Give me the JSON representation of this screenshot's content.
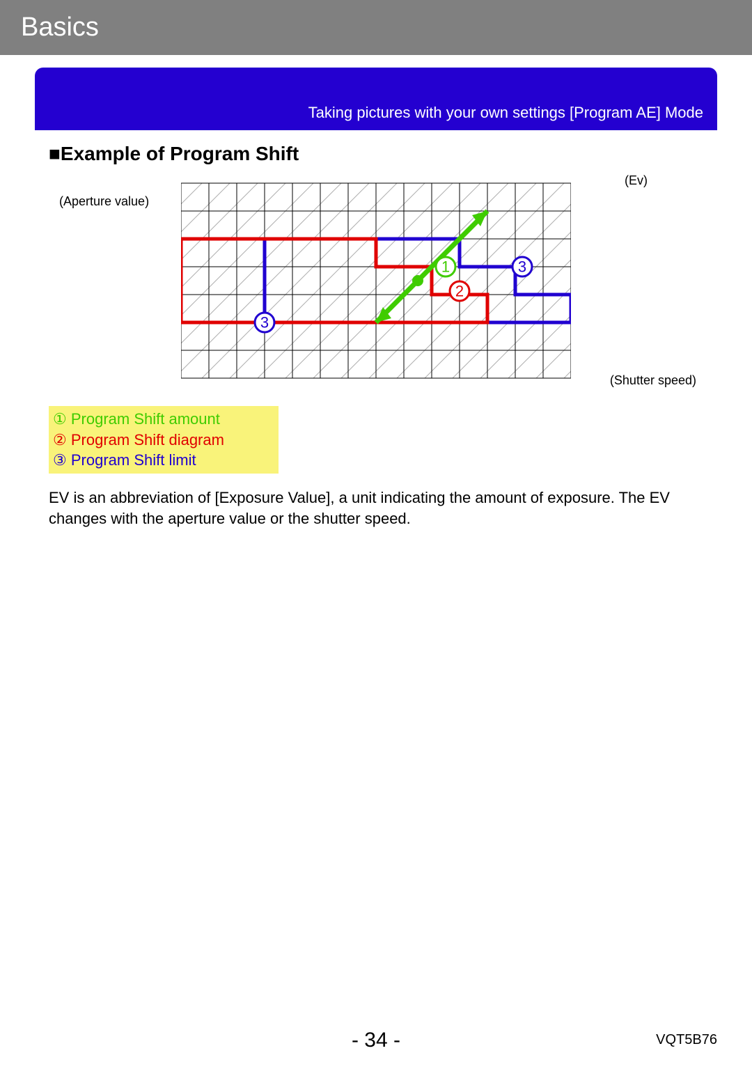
{
  "header": {
    "title": "Basics"
  },
  "banner": {
    "text": "Taking pictures with your own settings  [Program AE] Mode"
  },
  "section": {
    "title": "■Example of Program Shift"
  },
  "chart": {
    "label_aperture": "(Aperture value)",
    "label_ev": "(Ev)",
    "label_shutter": "(Shutter speed)",
    "markers": {
      "m1": "1",
      "m2": "2",
      "m3": "3"
    }
  },
  "legend": {
    "items": [
      {
        "num": "①",
        "text": "Program Shift amount",
        "color": "#3fcc00"
      },
      {
        "num": "②",
        "text": "Program Shift diagram",
        "color": "#e00000"
      },
      {
        "num": "③",
        "text": "Program Shift limit",
        "color": "#2000d0"
      }
    ]
  },
  "body": {
    "text": "EV is an abbreviation of [Exposure Value], a unit indicating the amount of exposure. The EV changes with the aperture value or the shutter speed."
  },
  "footer": {
    "page": "- 34 -",
    "doc_id": "VQT5B76"
  },
  "chart_data": {
    "type": "area",
    "title": "Example of Program Shift",
    "xlabel": "Shutter speed",
    "ylabel": "Aperture value",
    "grid_cols": 14,
    "grid_rows": 7,
    "series": [
      {
        "name": "Program Shift diagram (red staircase)",
        "color": "#e00000",
        "polyline_cells_xy": [
          [
            0,
            5
          ],
          [
            0,
            2
          ],
          [
            7,
            2
          ],
          [
            7,
            3
          ],
          [
            9,
            3
          ],
          [
            9,
            4
          ],
          [
            11,
            4
          ],
          [
            11,
            5
          ],
          [
            0,
            5
          ]
        ]
      },
      {
        "name": "Program Shift limit (blue staircase)",
        "color": "#2000d0",
        "polyline_cells_xy": [
          [
            3,
            5
          ],
          [
            3,
            2
          ],
          [
            10,
            2
          ],
          [
            10,
            3
          ],
          [
            12,
            3
          ],
          [
            12,
            4
          ],
          [
            14,
            4
          ],
          [
            14,
            5
          ],
          [
            3,
            5
          ]
        ]
      },
      {
        "name": "Program Shift amount arrow (green, diagonal Ev)",
        "color": "#3fcc00",
        "arrow_cells_xy": {
          "from": [
            7,
            5
          ],
          "to": [
            11,
            1
          ]
        }
      }
    ],
    "annotations": [
      {
        "label": "1",
        "pos_cells_xy": [
          9.5,
          3
        ],
        "color": "#3fcc00"
      },
      {
        "label": "2",
        "pos_cells_xy": [
          10,
          4
        ],
        "color": "#e00000"
      },
      {
        "label": "3",
        "pos_cells_xy": [
          12,
          3
        ],
        "color": "#2000d0"
      },
      {
        "label": "3",
        "pos_cells_xy": [
          3,
          5
        ],
        "color": "#2000d0"
      }
    ]
  }
}
